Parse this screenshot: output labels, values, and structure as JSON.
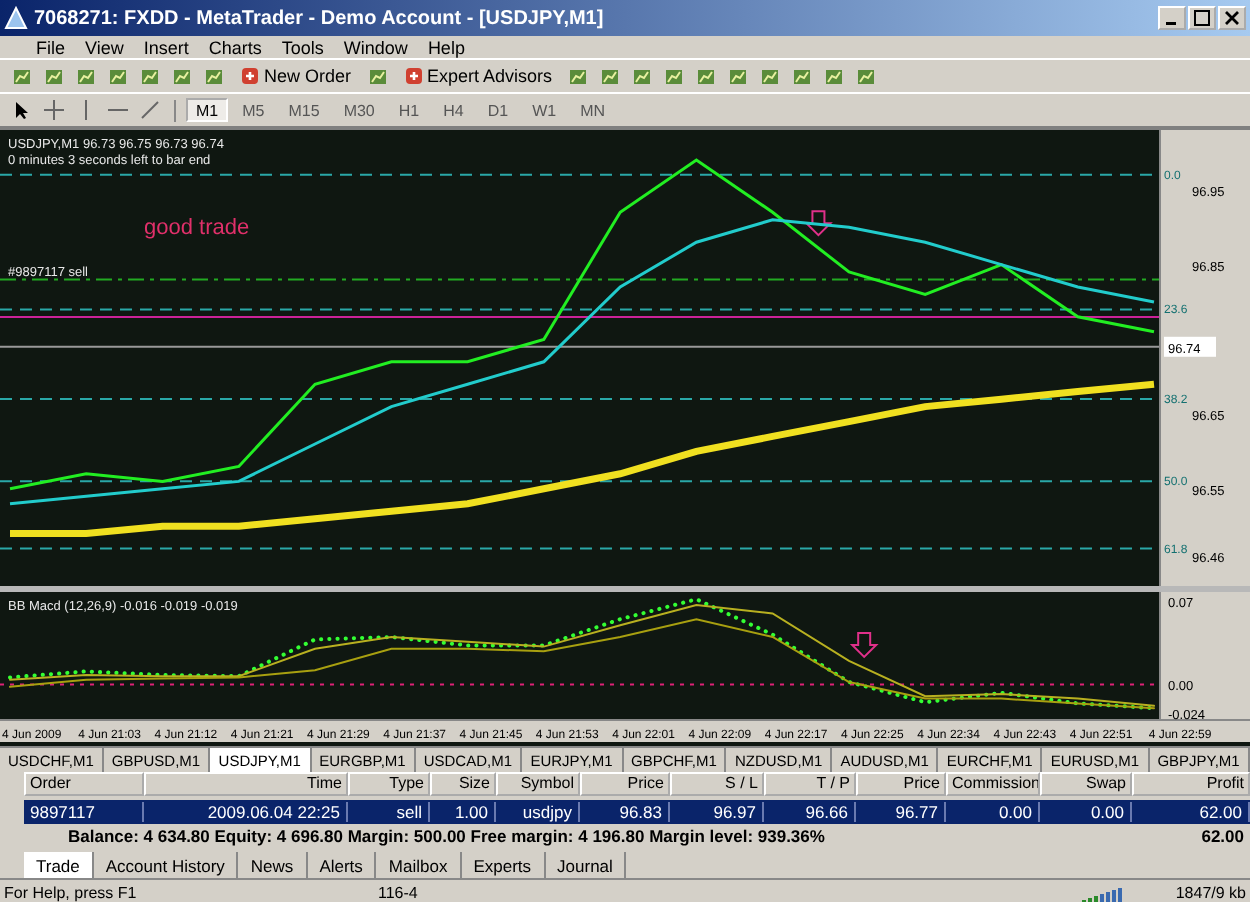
{
  "window": {
    "title": "7068271: FXDD - MetaTrader - Demo Account - [USDJPY,M1]"
  },
  "menu": [
    "File",
    "View",
    "Insert",
    "Charts",
    "Tools",
    "Window",
    "Help"
  ],
  "toolbar": {
    "buttons": [
      {
        "kind": "icon"
      },
      {
        "kind": "icon"
      },
      {
        "kind": "icon"
      },
      {
        "kind": "icon"
      },
      {
        "kind": "icon"
      },
      {
        "kind": "icon"
      },
      {
        "kind": "icon"
      },
      {
        "kind": "text",
        "label": "New Order"
      },
      {
        "kind": "icon"
      },
      {
        "kind": "text",
        "label": "Expert Advisors"
      },
      {
        "kind": "icon"
      },
      {
        "kind": "icon"
      },
      {
        "kind": "icon"
      },
      {
        "kind": "icon"
      },
      {
        "kind": "icon"
      },
      {
        "kind": "icon"
      },
      {
        "kind": "icon"
      },
      {
        "kind": "icon"
      },
      {
        "kind": "icon"
      },
      {
        "kind": "icon"
      }
    ]
  },
  "timeframes": [
    {
      "label": "M1",
      "selected": true
    },
    {
      "label": "M5",
      "selected": false
    },
    {
      "label": "M15",
      "selected": false
    },
    {
      "label": "M30",
      "selected": false
    },
    {
      "label": "H1",
      "selected": false
    },
    {
      "label": "H4",
      "selected": false
    },
    {
      "label": "D1",
      "selected": false
    },
    {
      "label": "W1",
      "selected": false
    },
    {
      "label": "MN",
      "selected": false
    }
  ],
  "price_chart": {
    "header": "USDJPY,M1  96.73 96.75 96.73 96.74",
    "countdown": "0 minutes 3 seconds left to bar end",
    "note": "good trade",
    "fib_labels": [
      "0.0",
      "23.6",
      "38.2",
      "50.0",
      "61.8"
    ],
    "order_label": "#9897117 sell",
    "current_price": "96.74",
    "chart_data": {
      "type": "line",
      "ylim": [
        96.42,
        97.03
      ],
      "yticks": [
        96.46,
        96.55,
        96.65,
        96.85,
        96.95
      ],
      "series": [
        {
          "color": "#22ee22",
          "values": [
            96.55,
            96.57,
            96.56,
            96.58,
            96.69,
            96.72,
            96.72,
            96.75,
            96.92,
            96.99,
            96.92,
            96.84,
            96.81,
            96.85,
            96.78,
            96.76
          ]
        },
        {
          "color": "#22cccc",
          "values": [
            96.53,
            96.54,
            96.55,
            96.56,
            96.61,
            96.66,
            96.69,
            96.72,
            96.82,
            96.88,
            96.91,
            96.9,
            96.88,
            96.85,
            96.82,
            96.8
          ]
        },
        {
          "color": "#f0e020",
          "values": [
            96.49,
            96.49,
            96.5,
            96.5,
            96.51,
            96.52,
            96.53,
            96.55,
            96.57,
            96.6,
            96.62,
            96.64,
            96.66,
            96.67,
            96.68,
            96.69
          ]
        }
      ],
      "ref_lines": [
        {
          "axis": "y",
          "value": 96.97,
          "color": "#2aa8a8",
          "line_style": "dashed"
        },
        {
          "axis": "y",
          "value": 96.79,
          "color": "#2aa8a8",
          "line_style": "dashed"
        },
        {
          "axis": "y",
          "value": 96.67,
          "color": "#2aa8a8",
          "line_style": "dashed"
        },
        {
          "axis": "y",
          "value": 96.56,
          "color": "#2aa8a8",
          "line_style": "dashed"
        },
        {
          "axis": "y",
          "value": 96.47,
          "color": "#2aa8a8",
          "line_style": "dashed"
        },
        {
          "axis": "y",
          "value": 96.83,
          "color": "#22aa22",
          "line_style": "dashdot"
        },
        {
          "axis": "y",
          "value": 96.78,
          "color": "#cc2299",
          "line_style": "solid"
        },
        {
          "axis": "y",
          "value": 96.74,
          "color": "#999999",
          "line_style": "solid"
        }
      ]
    }
  },
  "macd_chart": {
    "title": "BB Macd (12,26,9) -0.016 -0.019 -0.019",
    "chart_data": {
      "type": "line",
      "ylim": [
        -0.03,
        0.078
      ],
      "yticks": [
        0.07,
        {
          "value": 0,
          "label": "0.00"
        },
        {
          "value": -0.024,
          "label": "-0.024"
        }
      ],
      "categories": [
        "4 Jun 2009",
        "4 Jun 21:03",
        "4 Jun 21:12",
        "4 Jun 21:21",
        "4 Jun 21:29",
        "4 Jun 21:37",
        "4 Jun 21:45",
        "4 Jun 21:53",
        "4 Jun 22:01",
        "4 Jun 22:09",
        "4 Jun 22:17",
        "4 Jun 22:25",
        "4 Jun 22:34",
        "4 Jun 22:43",
        "4 Jun 22:51",
        "4 Jun 22:59"
      ],
      "series": [
        {
          "color": "#33ff33",
          "line_style": "dotted",
          "values": [
            0.006,
            0.011,
            0.008,
            0.007,
            0.038,
            0.04,
            0.033,
            0.033,
            0.055,
            0.072,
            0.042,
            0.002,
            -0.015,
            -0.007,
            -0.016,
            -0.02
          ]
        },
        {
          "color": "#b8b020",
          "values": [
            0.004,
            0.008,
            0.007,
            0.007,
            0.03,
            0.04,
            0.036,
            0.032,
            0.05,
            0.067,
            0.06,
            0.02,
            -0.01,
            -0.008,
            -0.012,
            -0.018
          ]
        },
        {
          "color": "#a8a010",
          "values": [
            -0.002,
            0.004,
            0.005,
            0.006,
            0.012,
            0.03,
            0.03,
            0.028,
            0.04,
            0.055,
            0.04,
            0.002,
            -0.012,
            -0.012,
            -0.016,
            -0.02
          ]
        }
      ],
      "ref_lines": [
        {
          "axis": "y",
          "value": 0,
          "color": "#dd2277",
          "line_style": "dotted"
        }
      ]
    }
  },
  "symbol_tabs": [
    {
      "label": "USDCHF,M1",
      "selected": false
    },
    {
      "label": "GBPUSD,M1",
      "selected": false
    },
    {
      "label": "USDJPY,M1",
      "selected": true
    },
    {
      "label": "EURGBP,M1",
      "selected": false
    },
    {
      "label": "USDCAD,M1",
      "selected": false
    },
    {
      "label": "EURJPY,M1",
      "selected": false
    },
    {
      "label": "GBPCHF,M1",
      "selected": false
    },
    {
      "label": "NZDUSD,M1",
      "selected": false
    },
    {
      "label": "AUDUSD,M1",
      "selected": false
    },
    {
      "label": "EURCHF,M1",
      "selected": false
    },
    {
      "label": "EURUSD,M1",
      "selected": false
    },
    {
      "label": "GBPJPY,M1",
      "selected": false
    }
  ],
  "terminal": {
    "columns": [
      "Order",
      "Time",
      "Type",
      "Size",
      "Symbol",
      "Price",
      "S / L",
      "T / P",
      "Price",
      "Commission",
      "Swap",
      "Profit"
    ],
    "rows": [
      {
        "selected": true,
        "cells": [
          "9897117",
          "2009.06.04 22:25",
          "sell",
          "1.00",
          "usdjpy",
          "96.83",
          "96.97",
          "96.66",
          "96.77",
          "0.00",
          "0.00",
          "62.00"
        ]
      }
    ],
    "summary": "Balance: 4 634.80  Equity: 4 696.80  Margin: 500.00  Free margin: 4 196.80  Margin level: 939.36%",
    "total": "62.00",
    "tabs": [
      {
        "label": "Trade",
        "selected": true
      },
      {
        "label": "Account History",
        "selected": false
      },
      {
        "label": "News",
        "selected": false
      },
      {
        "label": "Alerts",
        "selected": false
      },
      {
        "label": "Mailbox",
        "selected": false
      },
      {
        "label": "Experts",
        "selected": false
      },
      {
        "label": "Journal",
        "selected": false
      }
    ]
  },
  "status_bar": {
    "help": "For Help, press F1",
    "profile": "116-4",
    "traffic": "1847/9 kb"
  }
}
